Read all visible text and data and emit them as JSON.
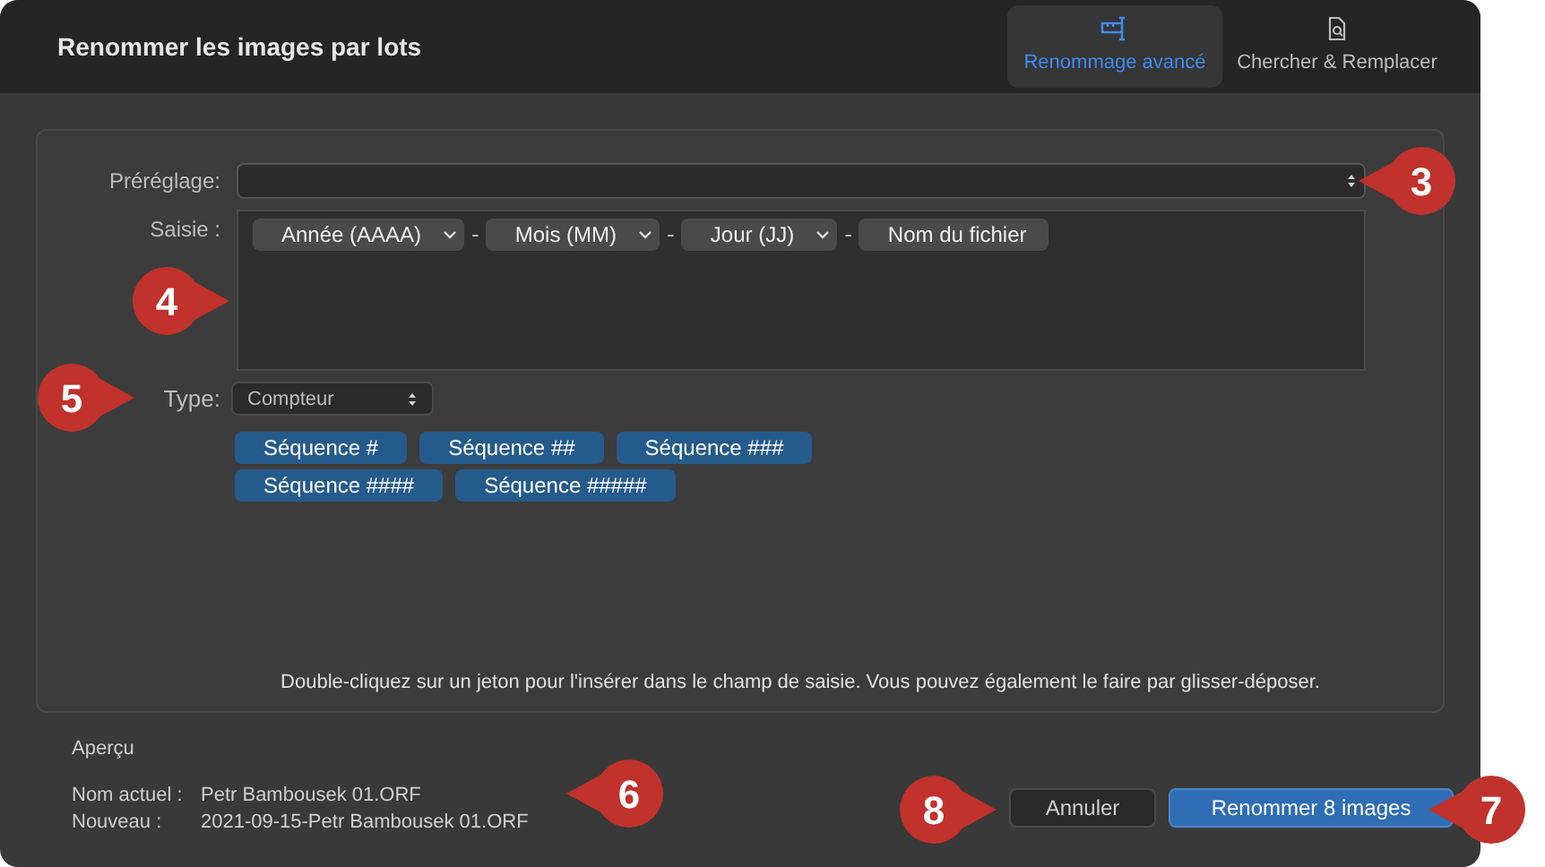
{
  "window": {
    "title": "Renommer les images par lots"
  },
  "tabs": [
    {
      "label": "Renommage avancé",
      "selected": true
    },
    {
      "label": "Chercher & Remplacer",
      "selected": false
    }
  ],
  "preset": {
    "label": "Préréglage:"
  },
  "input": {
    "label": "Saisie :",
    "items": [
      {
        "kind": "token",
        "label": "Année (AAAA)",
        "dropdown": true
      },
      {
        "kind": "separator",
        "label": "-"
      },
      {
        "kind": "token",
        "label": "Mois (MM)",
        "dropdown": true
      },
      {
        "kind": "separator",
        "label": "-"
      },
      {
        "kind": "token",
        "label": "Jour (JJ)",
        "dropdown": true
      },
      {
        "kind": "separator",
        "label": "-"
      },
      {
        "kind": "token",
        "label": "Nom du fichier",
        "dropdown": false
      }
    ]
  },
  "type": {
    "label": "Type:",
    "value": "Compteur"
  },
  "sequence_tokens": [
    "Séquence #",
    "Séquence ##",
    "Séquence ###",
    "Séquence ####",
    "Séquence #####"
  ],
  "hint": "Double-cliquez sur un jeton pour l'insérer dans le champ de saisie. Vous pouvez également le faire par glisser-déposer.",
  "preview": {
    "title": "Aperçu",
    "rows": [
      {
        "label": "Nom actuel :",
        "value": "Petr Bambousek 01.ORF"
      },
      {
        "label": "Nouveau :",
        "value": "2021-09-15-Petr Bambousek 01.ORF"
      }
    ]
  },
  "buttons": [
    {
      "label": "Annuler",
      "kind": "secondary"
    },
    {
      "label": "Renommer 8 images",
      "kind": "primary"
    }
  ],
  "callouts": [
    {
      "number": "3",
      "kind": "pointer-left"
    },
    {
      "number": "4",
      "kind": "pointer-right"
    },
    {
      "number": "5",
      "kind": "pointer-right"
    },
    {
      "number": "6",
      "kind": "pointer-left"
    },
    {
      "number": "8",
      "kind": "pointer-right"
    },
    {
      "number": "7",
      "kind": "pointer-left"
    }
  ]
}
